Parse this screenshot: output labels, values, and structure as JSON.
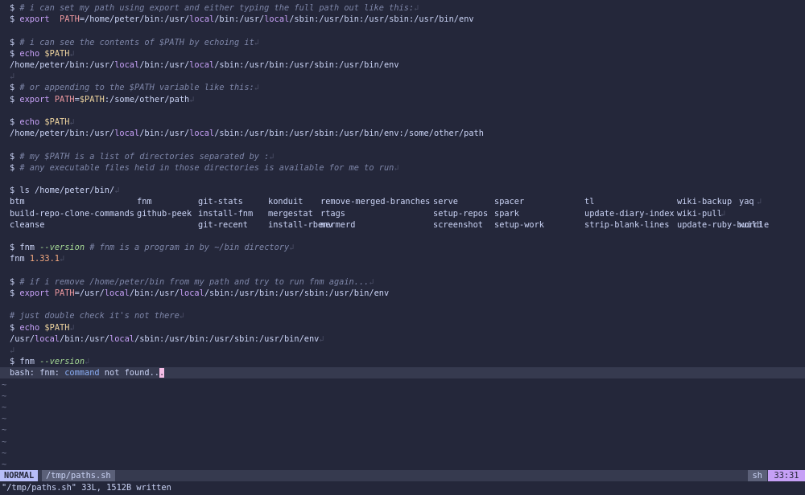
{
  "lines": [
    {
      "p": "$ ",
      "segs": [
        [
          "cmt",
          "# i can set my path using export and either typing the full path out like this:"
        ]
      ],
      "eol": true
    },
    {
      "p": "$ ",
      "segs": [
        [
          "kw",
          "export"
        ],
        [
          "",
          "  "
        ],
        [
          "var",
          "PATH"
        ],
        [
          "",
          "=/home/peter/bin:/usr/"
        ],
        [
          "lc",
          "local"
        ],
        [
          "",
          "/bin:/usr/"
        ],
        [
          "lc",
          "local"
        ],
        [
          "",
          "/sbin:/usr/bin:/usr/sbin:/usr/bin/env"
        ]
      ],
      "eol": false
    },
    {
      "p": "",
      "segs": [],
      "eol": false
    },
    {
      "p": "$ ",
      "segs": [
        [
          "cmt",
          "# i can see the contents of $PATH by echoing it"
        ]
      ],
      "eol": true
    },
    {
      "p": "$ ",
      "segs": [
        [
          "kw",
          "echo"
        ],
        [
          "",
          " "
        ],
        [
          "dvar",
          "$PATH"
        ]
      ],
      "eol": true
    },
    {
      "p": "",
      "segs": [
        [
          "",
          "/home/peter/bin:/usr/"
        ],
        [
          "lc",
          "local"
        ],
        [
          "",
          "/bin:/usr/"
        ],
        [
          "lc",
          "local"
        ],
        [
          "",
          "/sbin:/usr/bin:/usr/sbin:/usr/bin/env"
        ]
      ],
      "eol": false
    },
    {
      "p": "",
      "segs": [],
      "eol": true
    },
    {
      "p": "$ ",
      "segs": [
        [
          "cmt",
          "# or appending to the $PATH variable like this:"
        ]
      ],
      "eol": true
    },
    {
      "p": "$ ",
      "segs": [
        [
          "kw",
          "export"
        ],
        [
          "",
          " "
        ],
        [
          "var",
          "PATH"
        ],
        [
          "",
          "="
        ],
        [
          "dvar",
          "$PATH"
        ],
        [
          "",
          ":/some/other/path"
        ]
      ],
      "eol": true
    },
    {
      "p": "",
      "segs": [],
      "eol": false
    },
    {
      "p": "$ ",
      "segs": [
        [
          "kw",
          "echo"
        ],
        [
          "",
          " "
        ],
        [
          "dvar",
          "$PATH"
        ]
      ],
      "eol": true
    },
    {
      "p": "",
      "segs": [
        [
          "",
          "/home/peter/bin:/usr/"
        ],
        [
          "lc",
          "local"
        ],
        [
          "",
          "/bin:/usr/"
        ],
        [
          "lc",
          "local"
        ],
        [
          "",
          "/sbin:/usr/bin:/usr/sbin:/usr/bin/env:/some/other/path"
        ]
      ],
      "eol": false
    },
    {
      "p": "",
      "segs": [],
      "eol": false
    },
    {
      "p": "$ ",
      "segs": [
        [
          "cmt",
          "# my $PATH is a list of directories separated by :"
        ]
      ],
      "eol": true
    },
    {
      "p": "$ ",
      "segs": [
        [
          "cmt",
          "# any executable files held in those directories is available for me to run"
        ]
      ],
      "eol": true
    },
    {
      "p": "",
      "segs": [],
      "eol": false
    },
    {
      "p": "$ ",
      "segs": [
        [
          "",
          "ls /home/peter/bin/"
        ]
      ],
      "eol": true
    },
    {
      "ls": 0
    },
    {
      "ls": 1
    },
    {
      "ls": 2
    },
    {
      "p": "",
      "segs": [],
      "eol": false
    },
    {
      "p": "$ ",
      "segs": [
        [
          "",
          "fnm "
        ],
        [
          "flag",
          "--version"
        ],
        [
          "",
          " "
        ],
        [
          "cmt",
          "# fnm is a program in by ~/bin directory"
        ]
      ],
      "eol": true
    },
    {
      "p": "",
      "segs": [
        [
          "",
          "fnm "
        ],
        [
          "num",
          "1.33.1"
        ]
      ],
      "eol": true
    },
    {
      "p": "",
      "segs": [],
      "eol": false
    },
    {
      "p": "$ ",
      "segs": [
        [
          "cmt",
          "# if i remove /home/peter/bin from my path and try to run fnm again..."
        ]
      ],
      "eol": true
    },
    {
      "p": "$ ",
      "segs": [
        [
          "kw",
          "export"
        ],
        [
          "",
          " "
        ],
        [
          "var",
          "PATH"
        ],
        [
          "",
          "=/usr/"
        ],
        [
          "lc",
          "local"
        ],
        [
          "",
          "/bin:/usr/"
        ],
        [
          "lc",
          "local"
        ],
        [
          "",
          "/sbin:/usr/bin:/usr/sbin:/usr/bin/env"
        ]
      ],
      "eol": false
    },
    {
      "p": "",
      "segs": [],
      "eol": false
    },
    {
      "p": "",
      "segs": [
        [
          "cmt",
          "# just double check it's not there"
        ]
      ],
      "eol": true
    },
    {
      "p": "$ ",
      "segs": [
        [
          "kw",
          "echo"
        ],
        [
          "",
          " "
        ],
        [
          "dvar",
          "$PATH"
        ]
      ],
      "eol": true
    },
    {
      "p": "",
      "segs": [
        [
          "",
          "/usr/"
        ],
        [
          "lc",
          "local"
        ],
        [
          "",
          "/bin:/usr/"
        ],
        [
          "lc",
          "local"
        ],
        [
          "",
          "/sbin:/usr/bin:/usr/sbin:/usr/bin/env"
        ]
      ],
      "eol": true
    },
    {
      "p": "",
      "segs": [],
      "eol": true
    },
    {
      "p": "$ ",
      "segs": [
        [
          "",
          "fnm "
        ],
        [
          "flag",
          "--version"
        ]
      ],
      "eol": true
    },
    {
      "p": "",
      "segs": [
        [
          "",
          "bash: fnm: "
        ],
        [
          "bash",
          "command"
        ],
        [
          "",
          " not found.."
        ]
      ],
      "cursor": ".",
      "current": true
    }
  ],
  "ls_rows": [
    [
      "btm",
      "fnm",
      "git-stats",
      "konduit",
      "remove-merged-branches",
      "serve",
      "spacer",
      "tl",
      "wiki-backup",
      "yaq"
    ],
    [
      "build-repo-clone-commands",
      "github-peek",
      "install-fnm",
      "mergestat",
      "rtags",
      "setup-repos",
      "spark",
      "update-diary-index",
      "wiki-pull",
      ""
    ],
    [
      "cleanse",
      "",
      "git-recent",
      "install-rbenv",
      "mermerd",
      "screenshot",
      "setup-work",
      "strip-blank-lines",
      "update-ruby-build",
      "wordle"
    ]
  ],
  "tilde_count": 8,
  "eol_glyph": "↲",
  "tilde_glyph": "~",
  "statusline": {
    "mode": "NORMAL",
    "filename": "/tmp/paths.sh",
    "filetype": "sh",
    "position": "33:31"
  },
  "cmdline": "\"/tmp/paths.sh\" 33L, 1512B written",
  "colors": {
    "background": "#24273a",
    "comment": "#7e86a8",
    "keyword": "#c6a0f6",
    "mode_bg": "#b7bdf8",
    "cursor": "#f5bde6"
  }
}
